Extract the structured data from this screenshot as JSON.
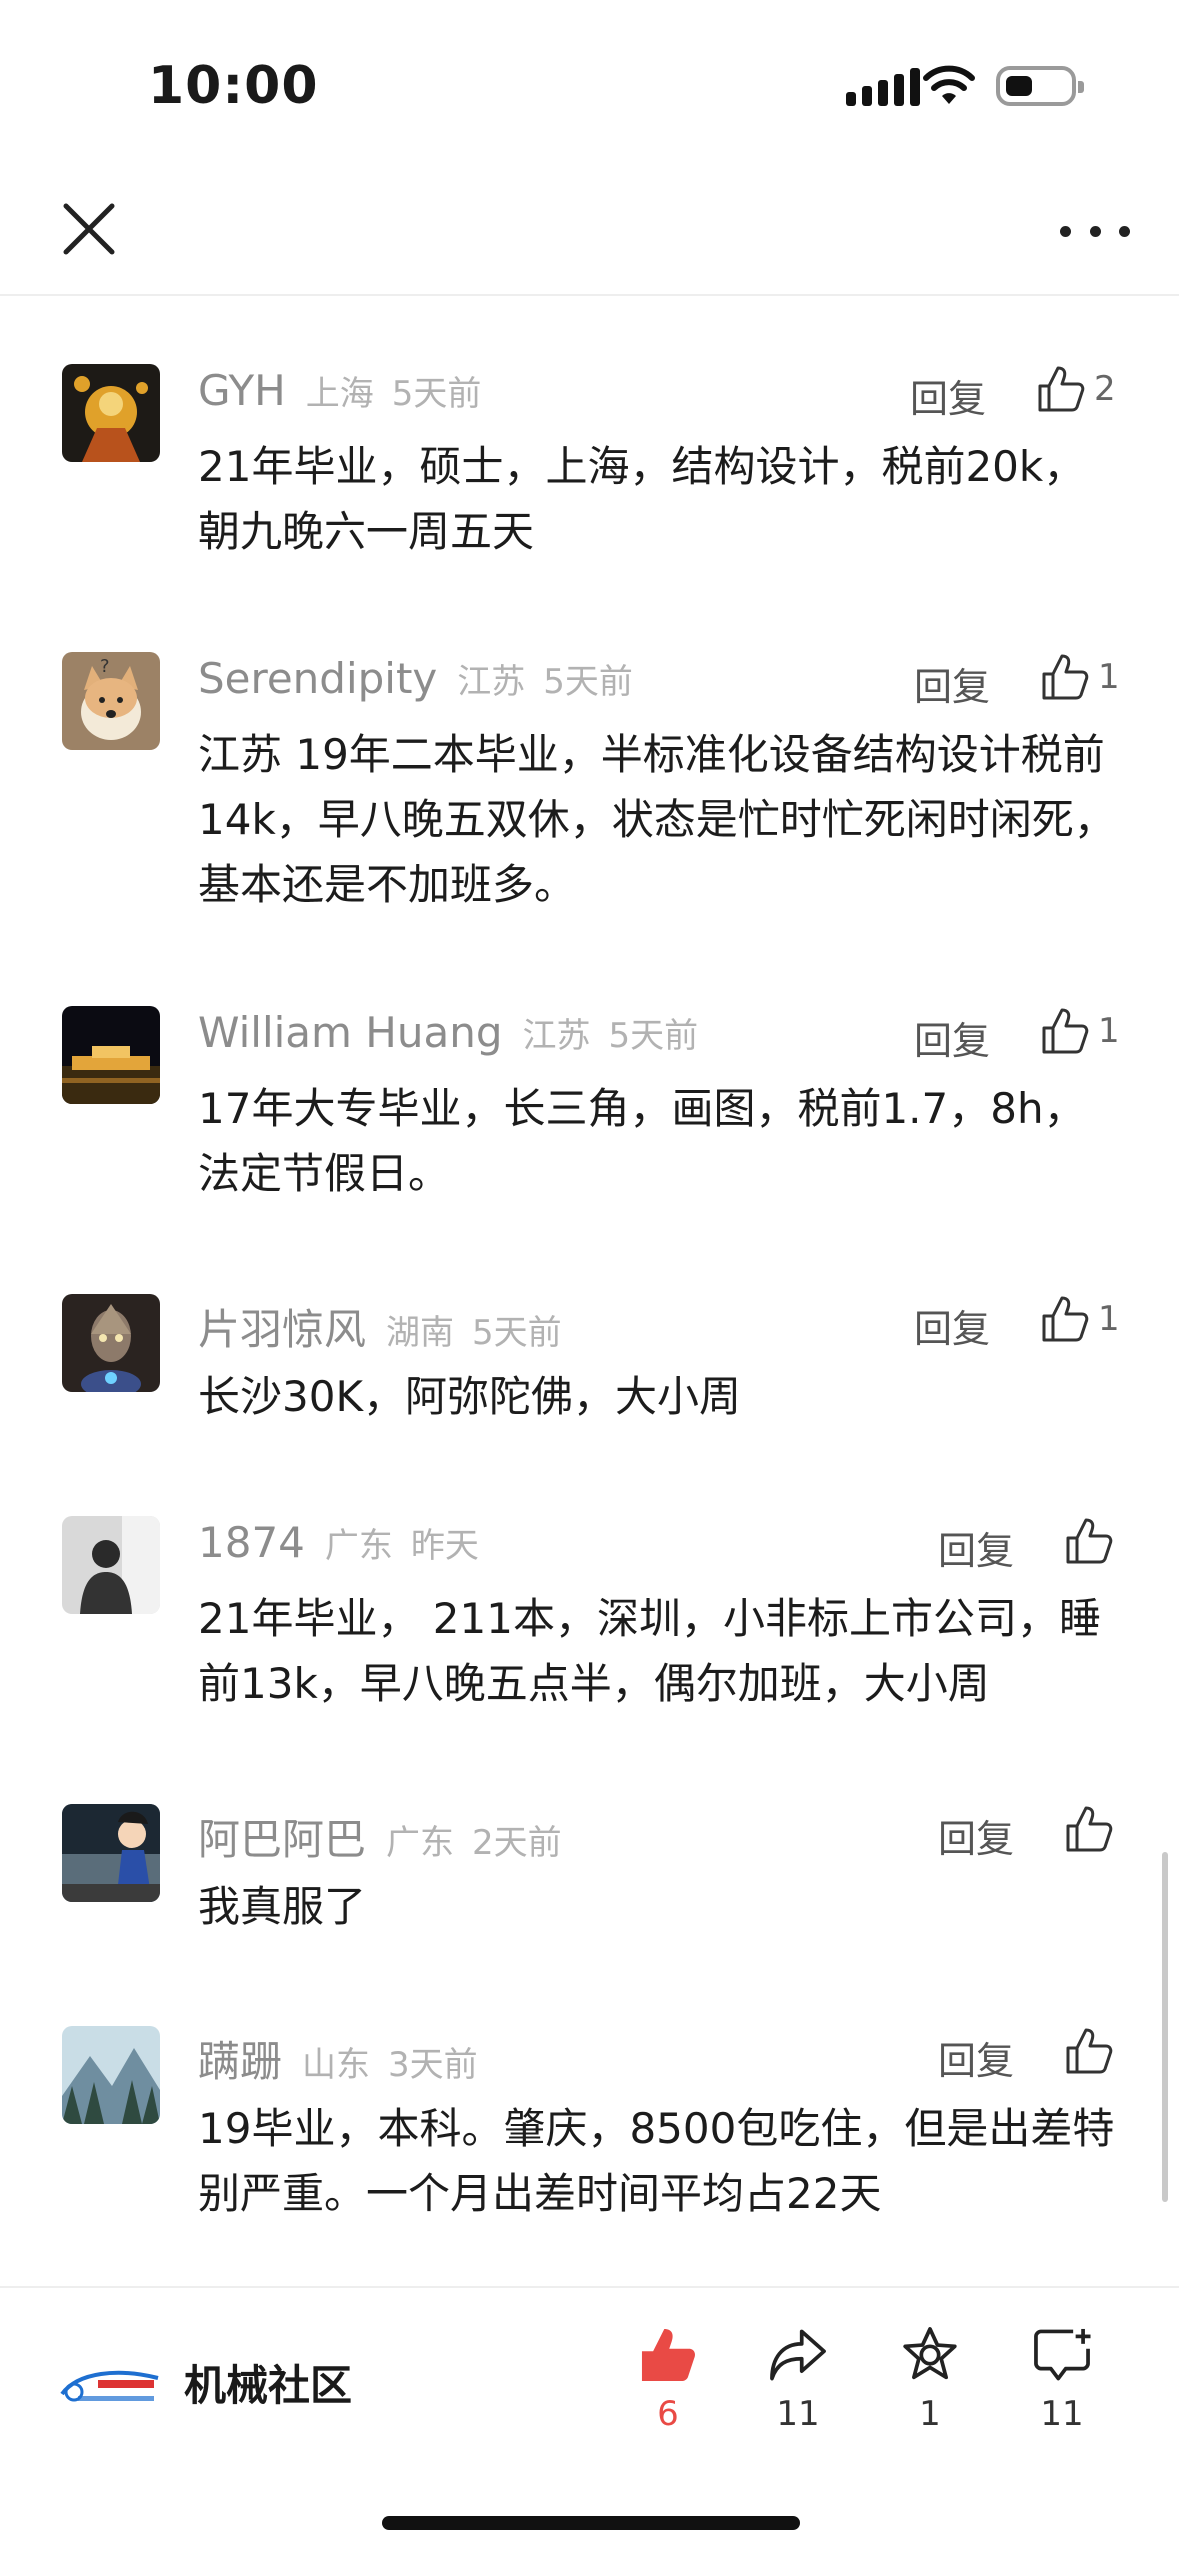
{
  "status_bar": {
    "time": "10:00"
  },
  "nav": {
    "close_icon": "close-icon",
    "more_icon": "more-dots-icon"
  },
  "comments": [
    {
      "name": "GYH",
      "location": "上海",
      "ago": "5天前",
      "reply": "回复",
      "likes": "2",
      "text": "21年毕业，硕士，上海，结构设计，税前20k，朝九晚六一周五天"
    },
    {
      "name": "Serendipity",
      "location": "江苏",
      "ago": "5天前",
      "reply": "回复",
      "likes": "1",
      "text": "江苏 19年二本毕业，半标准化设备结构设计税前14k，早八晚五双休，状态是忙时忙死闲时闲死，基本还是不加班多。"
    },
    {
      "name": "William Huang",
      "location": "江苏",
      "ago": "5天前",
      "reply": "回复",
      "likes": "1",
      "text": "17年大专毕业，长三角，画图，税前1.7，8h，法定节假日。"
    },
    {
      "name": "片羽惊风",
      "location": "湖南",
      "ago": "5天前",
      "reply": "回复",
      "likes": "1",
      "text": "长沙30K，阿弥陀佛，大小周"
    },
    {
      "name": "1874",
      "location": "广东",
      "ago": "昨天",
      "reply": "回复",
      "likes": "",
      "text": "21年毕业， 211本，深圳，小非标上市公司，睡前13k，早八晚五点半，偶尔加班，大小周"
    },
    {
      "name": "阿巴阿巴",
      "location": "广东",
      "ago": "2天前",
      "reply": "回复",
      "likes": "",
      "text": "我真服了"
    },
    {
      "name": "蹒跚",
      "location": "山东",
      "ago": "3天前",
      "reply": "回复",
      "likes": "",
      "text": "19毕业，本科。肇庆，8500包吃住，但是出差特别严重。一个月出差时间平均占22天"
    }
  ],
  "toolbar": {
    "brand_name": "机械社区",
    "like_count": "6",
    "share_count": "11",
    "favorite_count": "1",
    "comment_count": "11"
  },
  "colors": {
    "like_active": "#e94a45",
    "meta_gray": "#b2b2b2",
    "name_gray": "#8c8c8c"
  }
}
